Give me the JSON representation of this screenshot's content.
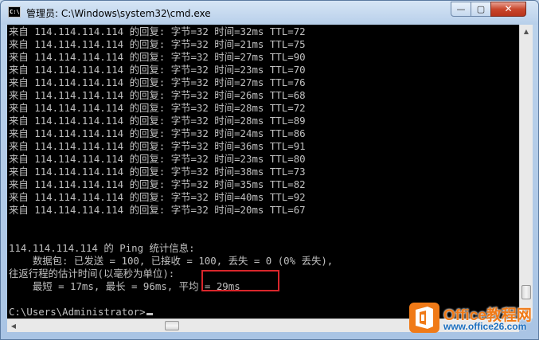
{
  "window": {
    "title": "管理员: C:\\Windows\\system32\\cmd.exe",
    "icon_label": "C:\\",
    "min_glyph": "—",
    "max_glyph": "▢",
    "close_glyph": "✕"
  },
  "console": {
    "lines": [
      "来自 114.114.114.114 的回复: 字节=32 时间=32ms TTL=72",
      "来自 114.114.114.114 的回复: 字节=32 时间=21ms TTL=75",
      "来自 114.114.114.114 的回复: 字节=32 时间=27ms TTL=90",
      "来自 114.114.114.114 的回复: 字节=32 时间=23ms TTL=70",
      "来自 114.114.114.114 的回复: 字节=32 时间=27ms TTL=76",
      "来自 114.114.114.114 的回复: 字节=32 时间=26ms TTL=68",
      "来自 114.114.114.114 的回复: 字节=32 时间=28ms TTL=72",
      "来自 114.114.114.114 的回复: 字节=32 时间=28ms TTL=89",
      "来自 114.114.114.114 的回复: 字节=32 时间=24ms TTL=86",
      "来自 114.114.114.114 的回复: 字节=32 时间=36ms TTL=91",
      "来自 114.114.114.114 的回复: 字节=32 时间=23ms TTL=80",
      "来自 114.114.114.114 的回复: 字节=32 时间=38ms TTL=73",
      "来自 114.114.114.114 的回复: 字节=32 时间=35ms TTL=82",
      "来自 114.114.114.114 的回复: 字节=32 时间=40ms TTL=92",
      "来自 114.114.114.114 的回复: 字节=32 时间=20ms TTL=67",
      "",
      "",
      "114.114.114.114 的 Ping 统计信息:",
      "    数据包: 已发送 = 100, 已接收 = 100, 丢失 = 0 (0% 丢失),",
      "往返行程的估计时间(以毫秒为单位):",
      "    最短 = 17ms, 最长 = 96ms, 平均 = 29ms",
      "",
      "C:\\Users\\Administrator>",
      "        半:"
    ]
  },
  "watermark": {
    "title": "Office教程网",
    "url": "www.office26.com"
  },
  "colors": {
    "console_bg": "#000000",
    "console_text": "#c0c0c0",
    "highlight_border": "#d9262b",
    "close_button": "#c9472d"
  }
}
